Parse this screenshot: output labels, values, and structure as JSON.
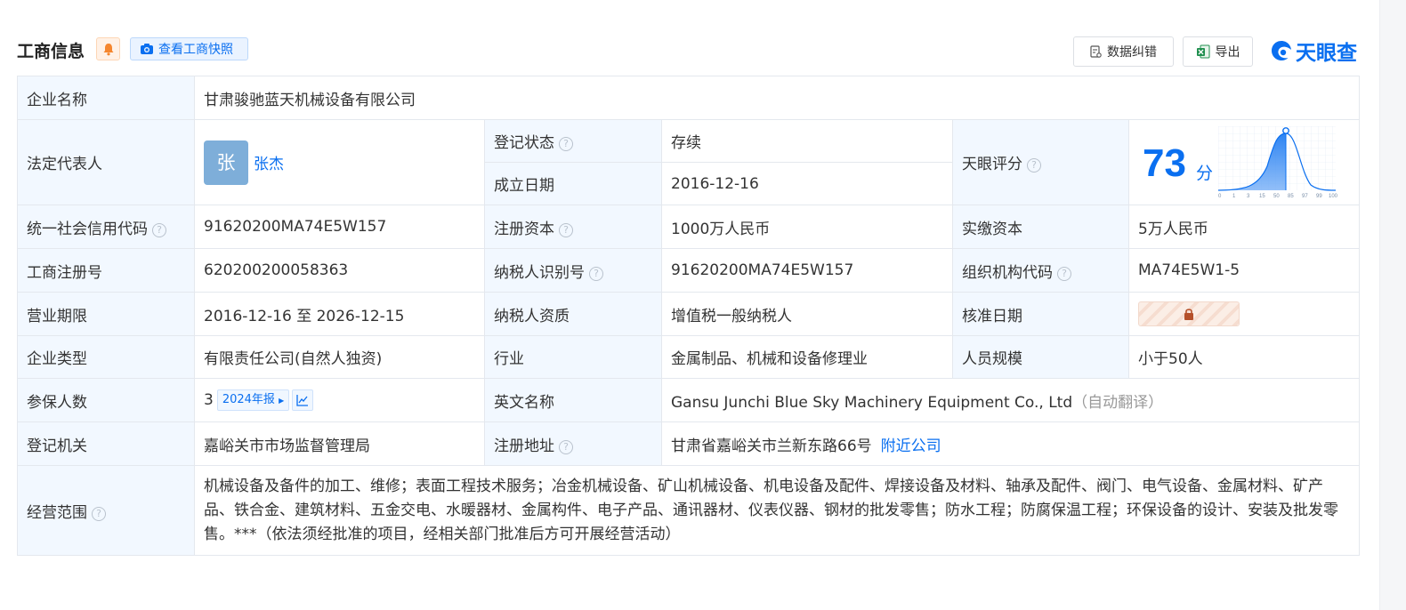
{
  "header": {
    "title": "工商信息",
    "snapshot_label": "查看工商快照",
    "correct_label": "数据纠错",
    "export_label": "导出",
    "logo_text": "天眼查"
  },
  "colors": {
    "accent": "#0a6ff0",
    "label_bg": "#f2f8ff",
    "status_green": "#27a34b",
    "bell_orange": "#f5862e"
  },
  "company": {
    "name_label": "企业名称",
    "name": "甘肃骏驰蓝天机械设备有限公司",
    "rep_label": "法定代表人",
    "rep_avatar": "张",
    "rep_name": "张杰",
    "status_label": "登记状态",
    "status": "存续",
    "found_label": "成立日期",
    "found_date": "2016-12-16",
    "score_label": "天眼评分",
    "score": "73",
    "score_unit": "分",
    "score_ticks": [
      "0",
      "1",
      "3",
      "15",
      "50",
      "85",
      "97",
      "99",
      "100"
    ],
    "credit_label": "统一社会信用代码",
    "credit_code": "91620200MA74E5W157",
    "reg_capital_label": "注册资本",
    "reg_capital": "1000万人民币",
    "paid_capital_label": "实缴资本",
    "paid_capital": "5万人民币",
    "reg_no_label": "工商注册号",
    "reg_no": "620200200058363",
    "taxpayer_id_label": "纳税人识别号",
    "taxpayer_id": "91620200MA74E5W157",
    "org_code_label": "组织机构代码",
    "org_code": "MA74E5W1-5",
    "term_label": "营业期限",
    "term": "2016-12-16 至 2026-12-15",
    "taxpayer_qual_label": "纳税人资质",
    "taxpayer_qual": "增值税一般纳税人",
    "approval_label": "核准日期",
    "type_label": "企业类型",
    "type": "有限责任公司(自然人独资)",
    "industry_label": "行业",
    "industry": "金属制品、机械和设备修理业",
    "staff_label": "人员规模",
    "staff": "小于50人",
    "insured_label": "参保人数",
    "insured": "3",
    "insured_report": "2024年报",
    "en_name_label": "英文名称",
    "en_name": "Gansu Junchi Blue Sky Machinery Equipment Co., Ltd",
    "en_name_note": "（自动翻译）",
    "authority_label": "登记机关",
    "authority": "嘉峪关市市场监督管理局",
    "address_label": "注册地址",
    "address": "甘肃省嘉峪关市兰新东路66号",
    "nearby_label": "附近公司",
    "scope_label": "经营范围",
    "scope": "机械设备及备件的加工、维修；表面工程技术服务；冶金机械设备、矿山机械设备、机电设备及配件、焊接设备及材料、轴承及配件、阀门、电气设备、金属材料、矿产品、铁合金、建筑材料、五金交电、水暖器材、金属构件、电子产品、通讯器材、仪表仪器、钢材的批发零售；防水工程；防腐保温工程；环保设备的设计、安装及批发零售。***（依法须经批准的项目，经相关部门批准后方可开展经营活动）"
  }
}
